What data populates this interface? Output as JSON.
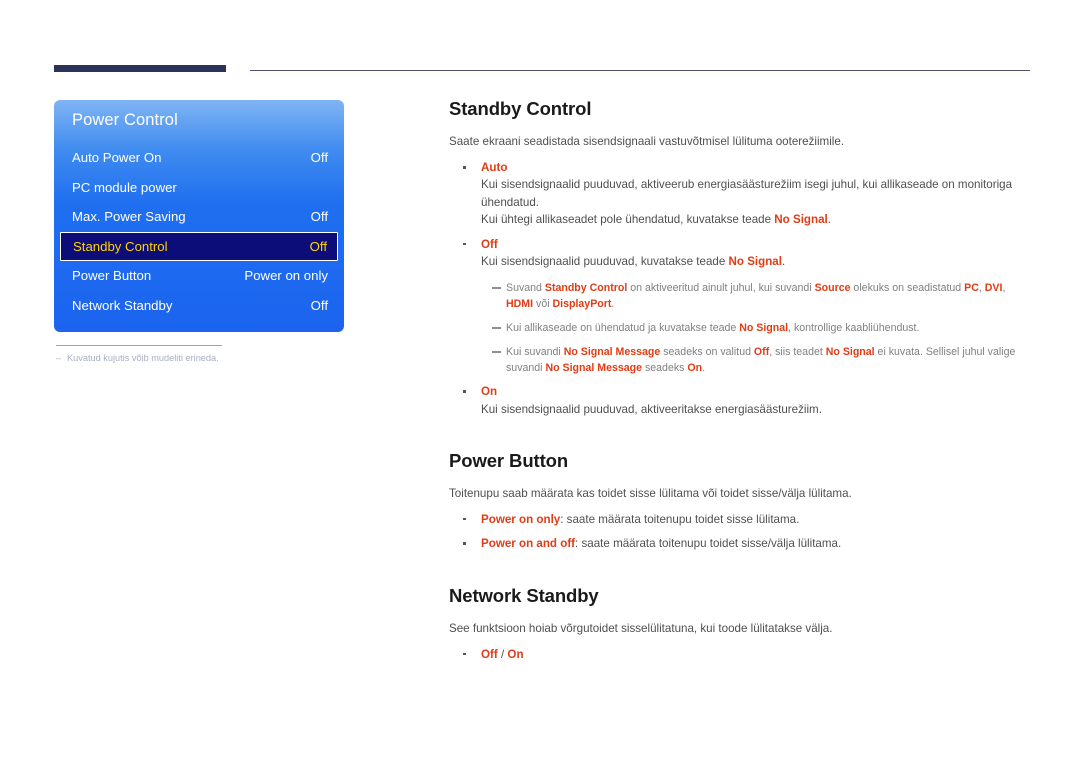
{
  "page": {
    "language": "et",
    "accent_color": "#e03c15",
    "osd_blue": "#1c64ef",
    "osd_highlight": "#0d0d7a",
    "osd_highlight_text": "#ffd400",
    "header_bar_color": "#2b3356"
  },
  "osd": {
    "title": "Power Control",
    "rows": [
      {
        "label": "Auto Power On",
        "value": "Off",
        "selected": false
      },
      {
        "label": "PC module power",
        "value": "",
        "selected": false
      },
      {
        "label": "Max. Power Saving",
        "value": "Off",
        "selected": false
      },
      {
        "label": "Standby Control",
        "value": "Off",
        "selected": true
      },
      {
        "label": "Power Button",
        "value": "Power on only",
        "selected": false
      },
      {
        "label": "Network Standby",
        "value": "Off",
        "selected": false
      }
    ],
    "footnote_dash": "–",
    "footnote": "Kuvatud kujutis võib mudeliti erineda."
  },
  "sections": {
    "standby_control": {
      "title": "Standby Control",
      "intro": "Saate ekraani seadistada sisendsignaali vastuvõtmisel lülituma ooterežiimile.",
      "options": [
        {
          "name": "Auto",
          "desc_line1": "Kui sisendsignaalid puuduvad, aktiveerub energiasäästurežiim isegi juhul, kui allikaseade on monitoriga ühendatud.",
          "desc_line2_a": "Kui ühtegi allikaseadet pole ühendatud, kuvatakse teade ",
          "desc_line2_kw": "No Signal",
          "desc_line2_b": "."
        },
        {
          "name": "Off",
          "desc_line1_a": "Kui sisendsignaalid puuduvad, kuvatakse teade ",
          "desc_line1_kw": "No Signal",
          "desc_line1_b": "."
        },
        {
          "name": "On",
          "desc_line1": "Kui sisendsignaalid puuduvad, aktiveeritakse energiasäästurežiim."
        }
      ],
      "notes": [
        {
          "t1": "Suvand ",
          "k1": "Standby Control",
          "t2": " on aktiveeritud ainult juhul, kui suvandi ",
          "k2": "Source",
          "t3": " olekuks on seadistatud ",
          "k3": "PC",
          "t4": ", ",
          "k4": "DVI",
          "t5": ", ",
          "k5": "HDMI",
          "t6": " või ",
          "k6": "DisplayPort",
          "t7": "."
        },
        {
          "t1": "Kui allikaseade on ühendatud ja kuvatakse teade ",
          "k1": "No Signal",
          "t2": ", kontrollige kaabliühendust."
        },
        {
          "t1": "Kui suvandi ",
          "k1": "No Signal Message",
          "t2": " seadeks on valitud ",
          "k2": "Off",
          "t3": ", siis teadet ",
          "k3": "No Signal",
          "t4": " ei kuvata. Sellisel juhul valige suvandi ",
          "k4": "No Signal Message",
          "t5": " seadeks ",
          "k5": "On",
          "t6": "."
        }
      ]
    },
    "power_button": {
      "title": "Power Button",
      "intro": "Toitenupu saab määrata kas toidet sisse lülitama või toidet sisse/välja lülitama.",
      "options": [
        {
          "name": "Power on only",
          "desc": ": saate määrata toitenupu toidet sisse lülitama."
        },
        {
          "name": "Power on and off",
          "desc": ": saate määrata toitenupu toidet sisse/välja lülitama."
        }
      ]
    },
    "network_standby": {
      "title": "Network Standby",
      "intro": "See funktsioon hoiab võrgutoidet sisselülitatuna, kui toode lülitatakse välja.",
      "options": [
        {
          "name_a": "Off",
          "sep": " / ",
          "name_b": "On"
        }
      ]
    }
  }
}
